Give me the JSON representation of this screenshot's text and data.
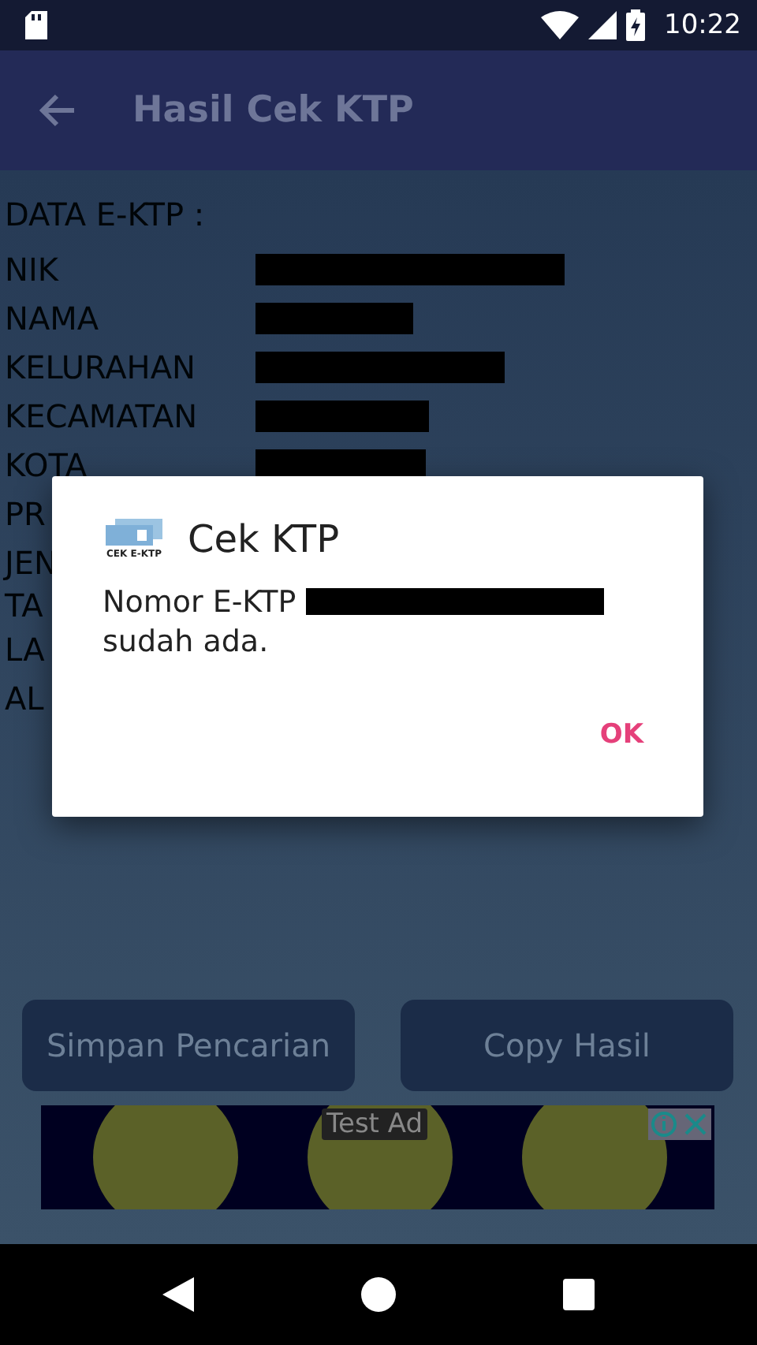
{
  "status_bar": {
    "time": "10:22"
  },
  "app_bar": {
    "title": "Hasil Cek KTP"
  },
  "data": {
    "heading": "DATA E-KTP :",
    "rows": [
      {
        "label": "NIK",
        "value_hidden": true
      },
      {
        "label": "NAMA",
        "value_hidden": true
      },
      {
        "label": "KELURAHAN",
        "value_hidden": true
      },
      {
        "label": "KECAMATAN",
        "value_hidden": true
      },
      {
        "label": "KOTA",
        "value_hidden": true
      },
      {
        "label": "PR"
      },
      {
        "label": "JEN"
      },
      {
        "label": "TA"
      },
      {
        "label": "LA"
      },
      {
        "label": "AL"
      }
    ]
  },
  "buttons": [
    "Simpan Pencarian",
    "Copy Hasil"
  ],
  "ad": {
    "label": "Test Ad"
  },
  "dialog": {
    "title": "Cek KTP",
    "logo_caption": "CEK E-KTP",
    "message_start": "Nomor E-KTP",
    "number_hidden": true,
    "message_end": "sudah ada.",
    "button": "OK"
  }
}
